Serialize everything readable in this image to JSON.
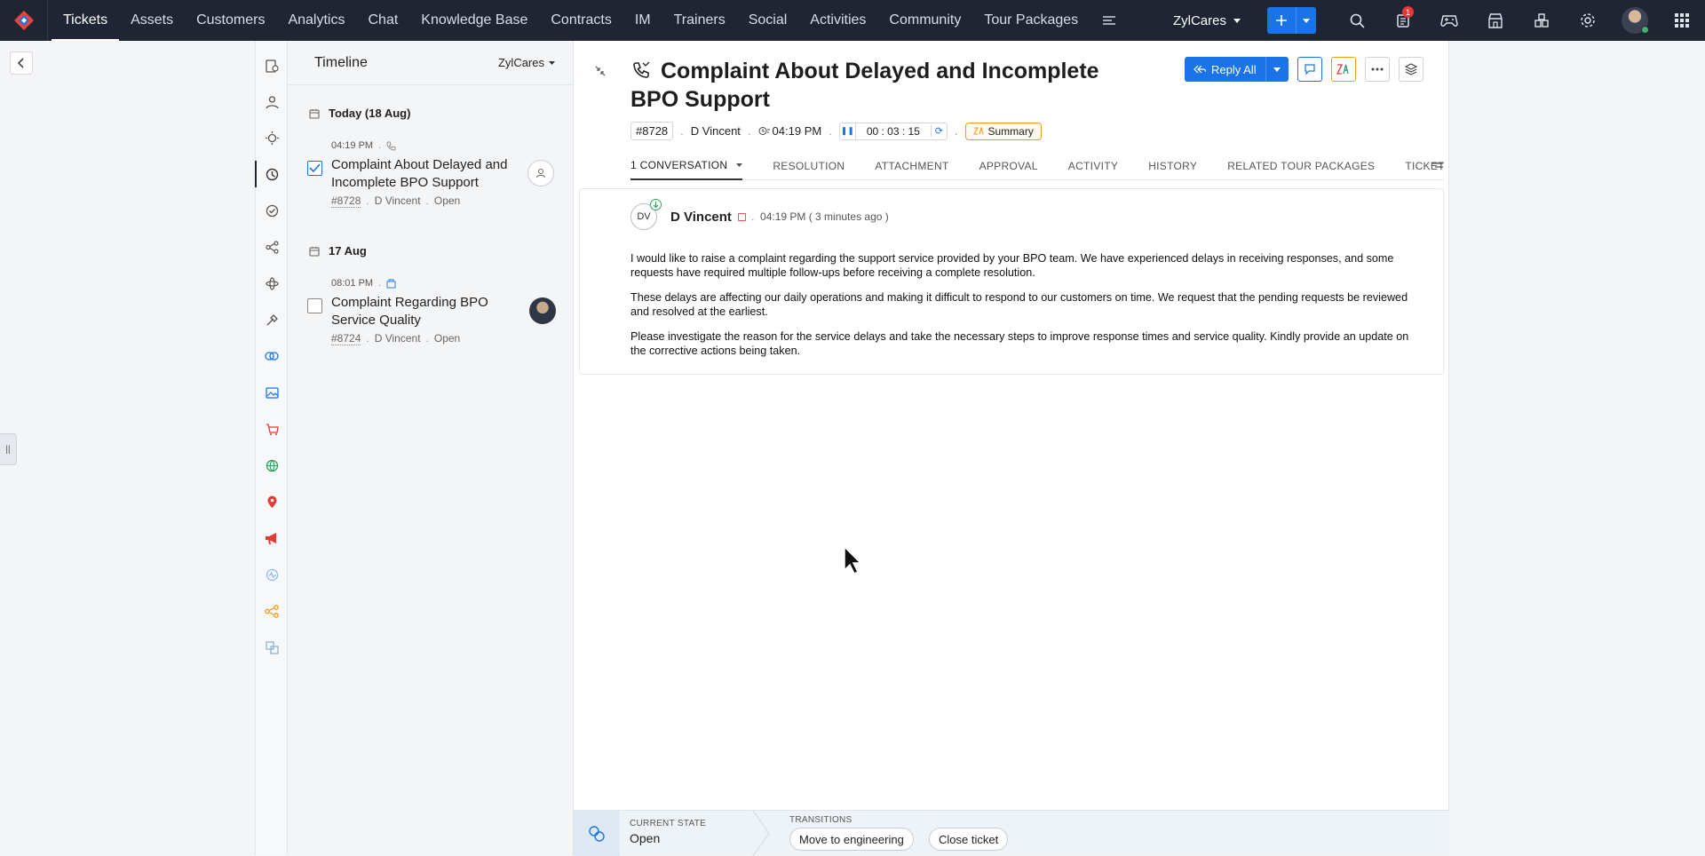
{
  "topbar": {
    "nav": [
      "Tickets",
      "Assets",
      "Customers",
      "Analytics",
      "Chat",
      "Knowledge Base",
      "Contracts",
      "IM",
      "Trainers",
      "Social",
      "Activities",
      "Community",
      "Tour Packages"
    ],
    "department": "ZylCares",
    "notification_count": "1"
  },
  "timeline": {
    "title": "Timeline",
    "department": "ZylCares",
    "groups": [
      {
        "date": "Today (18 Aug)",
        "time": "04:19 PM",
        "subject": "Complaint About Delayed and Incomplete BPO Support",
        "number": "#8728",
        "contact": "D Vincent",
        "status": "Open"
      },
      {
        "date": "17 Aug",
        "time": "08:01 PM",
        "subject": "Complaint Regarding BPO Service Quality",
        "number": "#8724",
        "contact": "D Vincent",
        "status": "Open"
      }
    ]
  },
  "ticket": {
    "subject": "Complaint About Delayed and Incomplete BPO Support",
    "number": "#8728",
    "contact": "D Vincent",
    "time": "04:19 PM",
    "timer": "00 : 03 : 15",
    "summary_label": "Summary",
    "reply_label": "Reply All",
    "tabs": [
      "1 CONVERSATION",
      "RESOLUTION",
      "ATTACHMENT",
      "APPROVAL",
      "ACTIVITY",
      "HISTORY",
      "RELATED TOUR PACKAGES",
      "TICKET"
    ]
  },
  "thread": {
    "initials": "DV",
    "sender": "D Vincent",
    "sent": "04:19 PM ( 3 minutes ago )",
    "paragraphs": [
      "I would like to raise a complaint regarding the support service provided by your BPO team. We have experienced delays in receiving responses, and some requests have required multiple follow-ups before receiving a complete resolution.",
      "These delays are affecting our daily operations and making it difficult to respond to our customers on time. We request that the pending requests be reviewed and resolved at the earliest.",
      "Please investigate the reason for the service delays and take the necessary steps to improve response times and service quality. Kindly provide an update on the corrective actions being taken."
    ]
  },
  "footer": {
    "current_state_label": "CURRENT STATE",
    "current_state": "Open",
    "transitions_label": "TRANSITIONS",
    "transitions": [
      "Move to engineering",
      "Close ticket"
    ]
  },
  "colors": {
    "topbar": "#1f2533",
    "accent": "#1a73e8",
    "summary_border": "#f39c12"
  }
}
